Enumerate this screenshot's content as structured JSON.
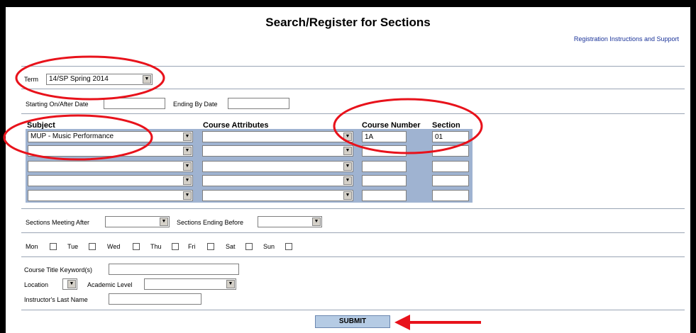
{
  "page_title": "Search/Register for Sections",
  "help_link": "Registration Instructions and Support",
  "term": {
    "label": "Term",
    "value": "14/SP  Spring 2014"
  },
  "dates": {
    "starting_label": "Starting On/After Date",
    "ending_label": "Ending By Date",
    "starting_value": "",
    "ending_value": ""
  },
  "grid": {
    "headers": {
      "subject": "Subject",
      "course_attributes": "Course Attributes",
      "course_number": "Course Number",
      "section": "Section"
    },
    "rows": [
      {
        "subject": "MUP - Music Performance",
        "attribute": "",
        "course_number": "1A",
        "section": "01"
      },
      {
        "subject": "",
        "attribute": "",
        "course_number": "",
        "section": ""
      },
      {
        "subject": "",
        "attribute": "",
        "course_number": "",
        "section": ""
      },
      {
        "subject": "",
        "attribute": "",
        "course_number": "",
        "section": ""
      },
      {
        "subject": "",
        "attribute": "",
        "course_number": "",
        "section": ""
      }
    ]
  },
  "meeting": {
    "after_label": "Sections Meeting After",
    "before_label": "Sections Ending Before",
    "after_value": "",
    "before_value": ""
  },
  "days": [
    "Mon",
    "Tue",
    "Wed",
    "Thu",
    "Fri",
    "Sat",
    "Sun"
  ],
  "keywords": {
    "label": "Course Title Keyword(s)",
    "value": ""
  },
  "location": {
    "label": "Location",
    "value": ""
  },
  "academic_level": {
    "label": "Academic Level",
    "value": ""
  },
  "instructor": {
    "label": "Instructor's Last Name",
    "value": ""
  },
  "submit_label": "SUBMIT",
  "colors": {
    "annotation_red": "#e8121b",
    "button_blue": "#b5cbe4",
    "link_blue": "#1a3399"
  }
}
